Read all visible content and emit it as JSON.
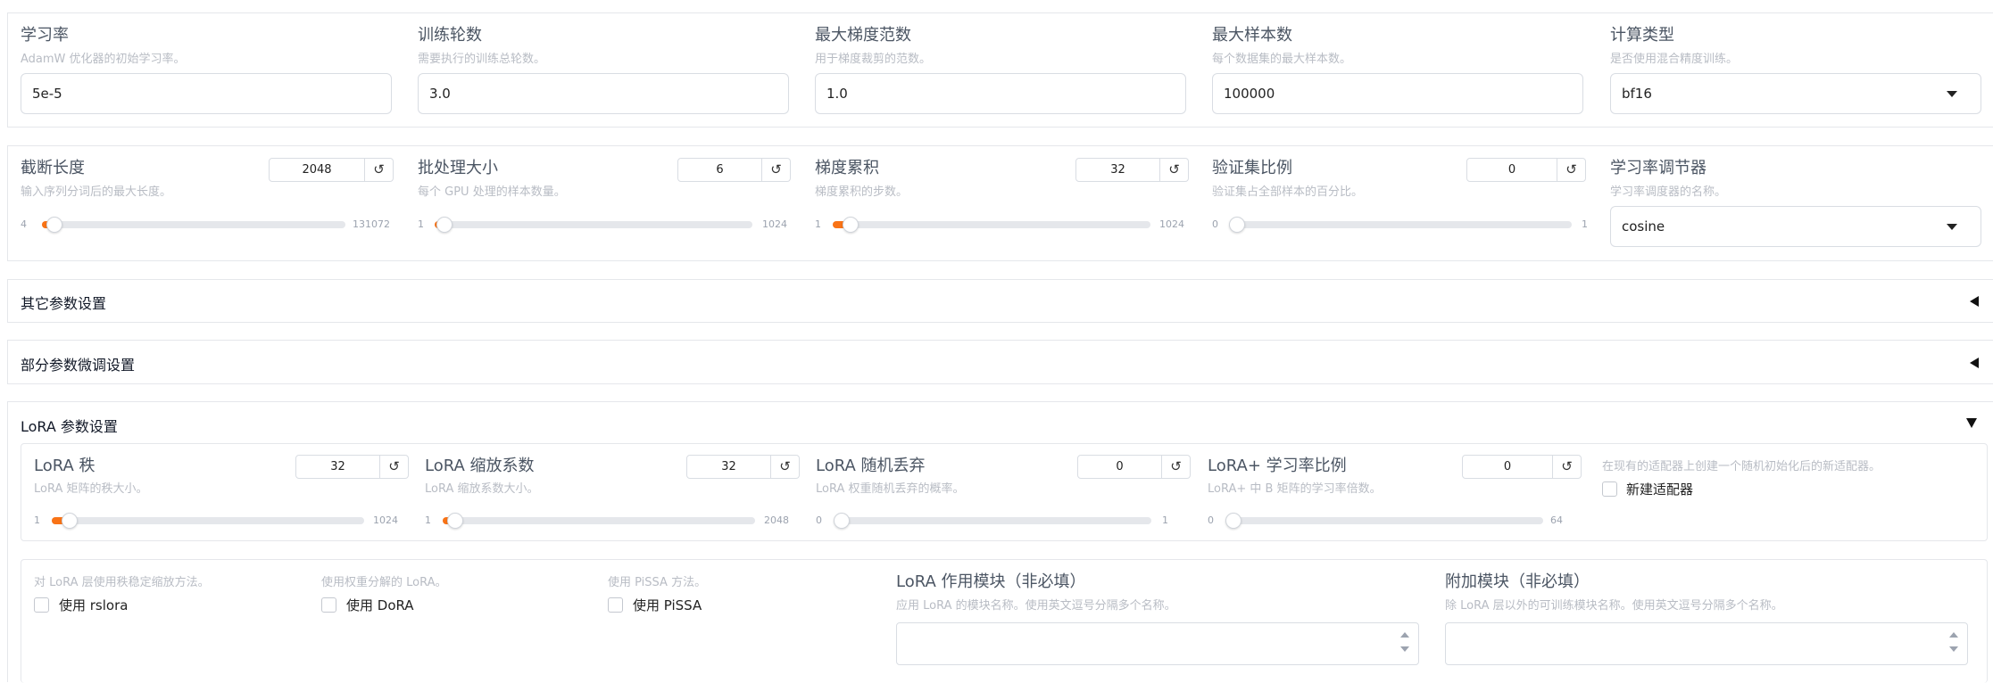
{
  "row1": {
    "lr": {
      "label": "学习率",
      "info": "AdamW 优化器的初始学习率。",
      "value": "5e-5"
    },
    "epochs": {
      "label": "训练轮数",
      "info": "需要执行的训练总轮数。",
      "value": "3.0"
    },
    "max_grad_norm": {
      "label": "最大梯度范数",
      "info": "用于梯度裁剪的范数。",
      "value": "1.0"
    },
    "max_samples": {
      "label": "最大样本数",
      "info": "每个数据集的最大样本数。",
      "value": "100000"
    },
    "compute_type": {
      "label": "计算类型",
      "info": "是否使用混合精度训练。",
      "value": "bf16"
    }
  },
  "row2": {
    "cutoff_len": {
      "label": "截断长度",
      "info": "输入序列分词后的最大长度。",
      "value": "2048",
      "min": "4",
      "max": "131072",
      "fraction": 0.016
    },
    "batch_size": {
      "label": "批处理大小",
      "info": "每个 GPU 处理的样本数量。",
      "value": "6",
      "min": "1",
      "max": "1024",
      "fraction": 0.005
    },
    "grad_accum": {
      "label": "梯度累积",
      "info": "梯度累积的步数。",
      "value": "32",
      "min": "1",
      "max": "1024",
      "fraction": 0.03
    },
    "val_size": {
      "label": "验证集比例",
      "info": "验证集占全部样本的百分比。",
      "value": "0",
      "min": "0",
      "max": "1",
      "fraction": 0.0
    },
    "lr_scheduler": {
      "label": "学习率调节器",
      "info": "学习率调度器的名称。",
      "value": "cosine"
    }
  },
  "accordions": {
    "extra": "其它参数设置",
    "freeze": "部分参数微调设置",
    "lora": "LoRA 参数设置"
  },
  "lora": {
    "rank": {
      "label": "LoRA 秩",
      "info": "LoRA 矩阵的秩大小。",
      "value": "32",
      "min": "1",
      "max": "1024",
      "fraction": 0.03
    },
    "alpha": {
      "label": "LoRA 缩放系数",
      "info": "LoRA 缩放系数大小。",
      "value": "32",
      "min": "1",
      "max": "2048",
      "fraction": 0.015
    },
    "dropout": {
      "label": "LoRA 随机丢弃",
      "info": "LoRA 权重随机丢弃的概率。",
      "value": "0",
      "min": "0",
      "max": "1",
      "fraction": 0.0
    },
    "plus_lr_ratio": {
      "label": "LoRA+ 学习率比例",
      "info": "LoRA+ 中 B 矩阵的学习率倍数。",
      "value": "0",
      "min": "0",
      "max": "64",
      "fraction": 0.0
    },
    "create_new_adapter": {
      "info": "在现有的适配器上创建一个随机初始化后的新适配器。",
      "label": "新建适配器",
      "checked": false
    },
    "rslora": {
      "info": "对 LoRA 层使用秩稳定缩放方法。",
      "label": "使用 rslora",
      "checked": false
    },
    "dora": {
      "info": "使用权重分解的 LoRA。",
      "label": "使用 DoRA",
      "checked": false
    },
    "pissa": {
      "info": "使用 PiSSA 方法。",
      "label": "使用 PiSSA",
      "checked": false
    },
    "target": {
      "label": "LoRA 作用模块（非必填）",
      "info": "应用 LoRA 的模块名称。使用英文逗号分隔多个名称。",
      "value": ""
    },
    "additional_target": {
      "label": "附加模块（非必填）",
      "info": "除 LoRA 层以外的可训练模块名称。使用英文逗号分隔多个名称。",
      "value": ""
    }
  },
  "colors": {
    "accent": "#f97316",
    "border": "#e5e7eb"
  }
}
